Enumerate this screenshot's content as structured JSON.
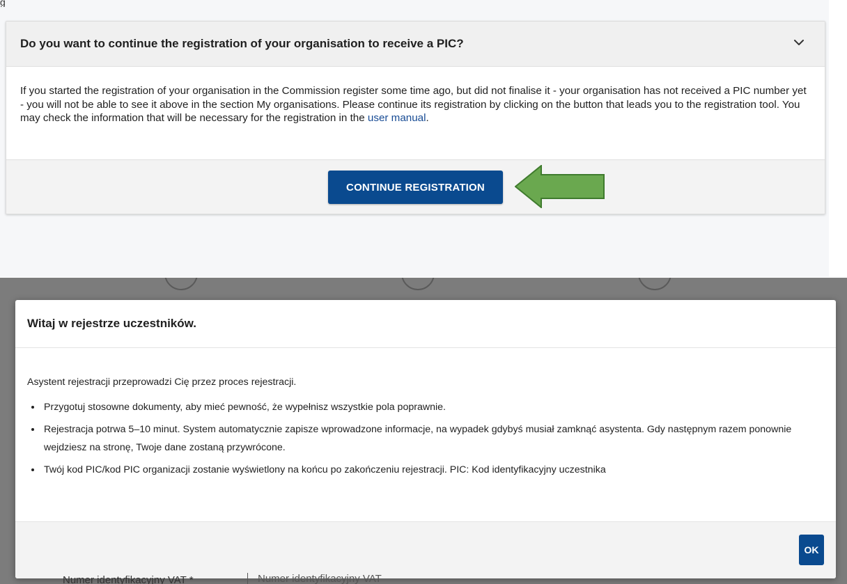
{
  "accordion": {
    "title": "Do you want to continue the registration of your organisation to receive a PIC?",
    "body_text": "If you started the registration of your organisation in the Commission register some time ago, but did not finalise it - your organisation has not received a PIC number yet - you will not be able to see it above in the section My organisations. Please continue its registration by clicking on the button that leads you to the registration tool. You may check the information that will be necessary for the registration in the ",
    "link_text": "user manual",
    "body_end": ".",
    "button_label": "CONTINUE REGISTRATION",
    "icon": "chevron-down-icon"
  },
  "annotation": {
    "arrow_color": "#6aa84f",
    "icon": "arrow-left-icon"
  },
  "modal": {
    "title": "Witaj w rejestrze uczestników.",
    "intro": "Asystent rejestracji przeprowadzi Cię przez proces rejestracji.",
    "bullets": [
      "Przygotuj stosowne dokumenty, aby mieć pewność, że wypełnisz wszystkie pola poprawnie.",
      "Rejestracja potrwa 5–10 minut. System automatycznie zapisze wprowadzone informacje, na wypadek gdybyś musiał zamknąć asystenta. Gdy następnym razem ponownie wejdziesz na stronę, Twoje dane zostaną przywrócone.",
      "Twój kod PIC/kod PIC organizacji zostanie wyświetlony na końcu po zakończeniu rejestracji. PIC: Kod identyfikacyjny uczestnika"
    ],
    "ok_label": "OK"
  },
  "background": {
    "field_label": "Numer identyfikacyjny VAT",
    "field_placeholder": "Numer identyfikacyjny VAT"
  },
  "colors": {
    "primary_button": "#0a4a8f",
    "link": "#174b94",
    "overlay": "#7c7c7c"
  }
}
